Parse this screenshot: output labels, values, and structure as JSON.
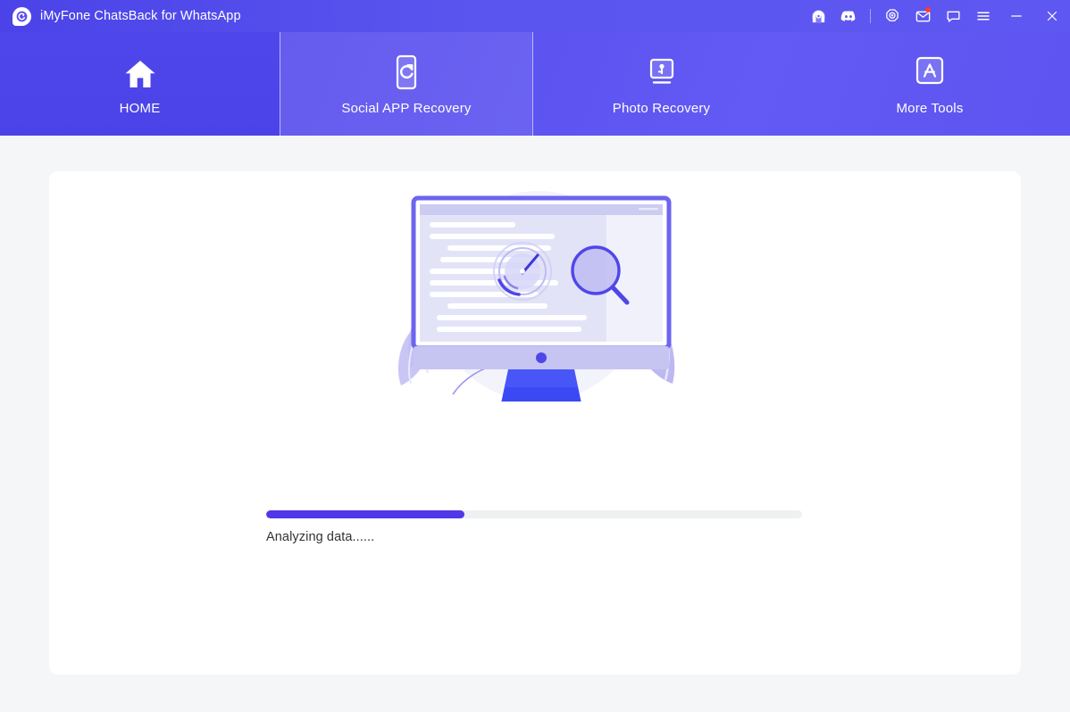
{
  "window": {
    "title": "iMyFone ChatsBack for WhatsApp",
    "logo_icon": "imyfone-logo-icon",
    "controls": [
      {
        "name": "support-headset-icon",
        "label": "Support"
      },
      {
        "name": "discord-icon",
        "label": "Discord"
      },
      {
        "name": "divider",
        "label": ""
      },
      {
        "name": "target-icon",
        "label": "Activate"
      },
      {
        "name": "mail-icon",
        "label": "Messages"
      },
      {
        "name": "chat-bubble-icon",
        "label": "Feedback"
      },
      {
        "name": "hamburger-menu-icon",
        "label": "Menu"
      },
      {
        "name": "minimize-icon",
        "label": "Minimize"
      },
      {
        "name": "close-icon",
        "label": "Close"
      }
    ],
    "mail_badge": true
  },
  "nav": {
    "tabs": [
      {
        "label": "HOME",
        "icon": "home-icon",
        "state": "active"
      },
      {
        "label": "Social APP Recovery",
        "icon": "phone-refresh-icon",
        "state": "highlighted"
      },
      {
        "label": "Photo Recovery",
        "icon": "monitor-person-icon",
        "state": "normal"
      },
      {
        "label": "More Tools",
        "icon": "app-store-icon",
        "state": "normal"
      }
    ]
  },
  "main": {
    "illustration": "analyzing-computer-illustration",
    "progress": {
      "percent": 37,
      "status": "Analyzing data......"
    }
  },
  "colors": {
    "brand": "#4f46ea",
    "titlebar": "#4f46ea",
    "progress_fill": "#4f38e8",
    "progress_track": "#eef0f2",
    "page_bg": "#f5f6f8",
    "card_bg": "#ffffff",
    "badge": "#ff3b30"
  }
}
